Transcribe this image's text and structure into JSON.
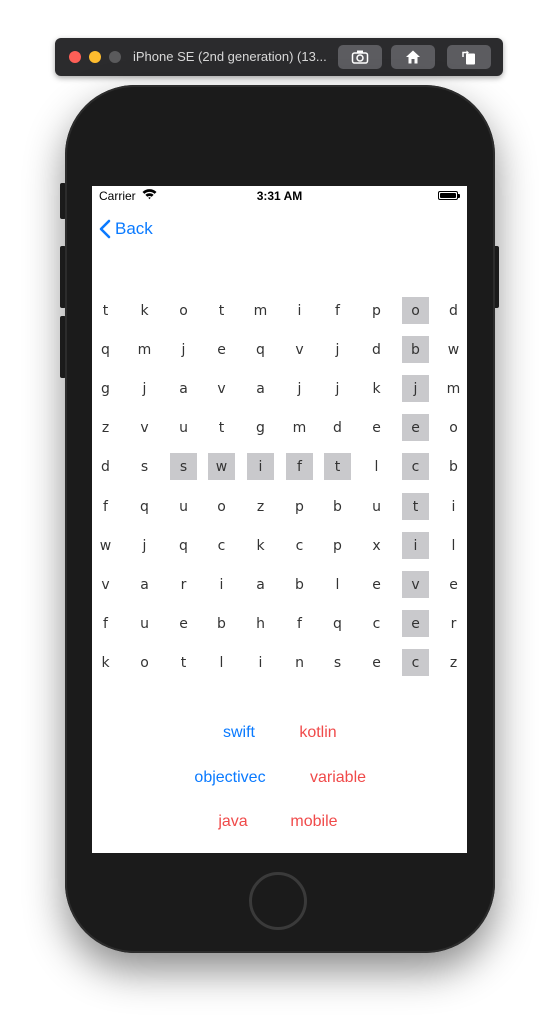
{
  "simulator": {
    "title": "iPhone SE (2nd generation) (13...",
    "buttons": [
      "screenshot-icon",
      "home-icon",
      "rotate-icon"
    ]
  },
  "status_bar": {
    "carrier": "Carrier",
    "time": "3:31 AM"
  },
  "nav": {
    "back_label": "Back"
  },
  "colors": {
    "accent": "#0a7aff",
    "found": "#0a7aff",
    "not_found": "#f04a4a",
    "highlight": "#c9c9cc"
  },
  "grid": {
    "rows": [
      [
        "t",
        "k",
        "o",
        "t",
        "m",
        "i",
        "f",
        "p",
        "o",
        "d"
      ],
      [
        "q",
        "m",
        "j",
        "e",
        "q",
        "v",
        "j",
        "d",
        "b",
        "w"
      ],
      [
        "g",
        "j",
        "a",
        "v",
        "a",
        "j",
        "j",
        "k",
        "j",
        "m"
      ],
      [
        "z",
        "v",
        "u",
        "t",
        "g",
        "m",
        "d",
        "e",
        "e",
        "o"
      ],
      [
        "d",
        "s",
        "s",
        "w",
        "i",
        "f",
        "t",
        "l",
        "c",
        "b"
      ],
      [
        "f",
        "q",
        "u",
        "o",
        "z",
        "p",
        "b",
        "u",
        "t",
        "i"
      ],
      [
        "w",
        "j",
        "q",
        "c",
        "k",
        "c",
        "p",
        "x",
        "i",
        "l"
      ],
      [
        "v",
        "a",
        "r",
        "i",
        "a",
        "b",
        "l",
        "e",
        "v",
        "e"
      ],
      [
        "f",
        "u",
        "e",
        "b",
        "h",
        "f",
        "q",
        "c",
        "e",
        "r"
      ],
      [
        "k",
        "o",
        "t",
        "l",
        "i",
        "n",
        "s",
        "e",
        "c",
        "z"
      ]
    ],
    "highlighted": [
      [
        4,
        2
      ],
      [
        4,
        3
      ],
      [
        4,
        4
      ],
      [
        4,
        5
      ],
      [
        4,
        6
      ],
      [
        0,
        8
      ],
      [
        1,
        8
      ],
      [
        2,
        8
      ],
      [
        3,
        8
      ],
      [
        4,
        8
      ],
      [
        5,
        8
      ],
      [
        6,
        8
      ],
      [
        7,
        8
      ],
      [
        8,
        8
      ],
      [
        9,
        8
      ]
    ]
  },
  "words": [
    {
      "text": "swift",
      "found": true
    },
    {
      "text": "kotlin",
      "found": false
    },
    {
      "text": "objectivec",
      "found": true
    },
    {
      "text": "variable",
      "found": false
    },
    {
      "text": "java",
      "found": false
    },
    {
      "text": "mobile",
      "found": false
    }
  ]
}
